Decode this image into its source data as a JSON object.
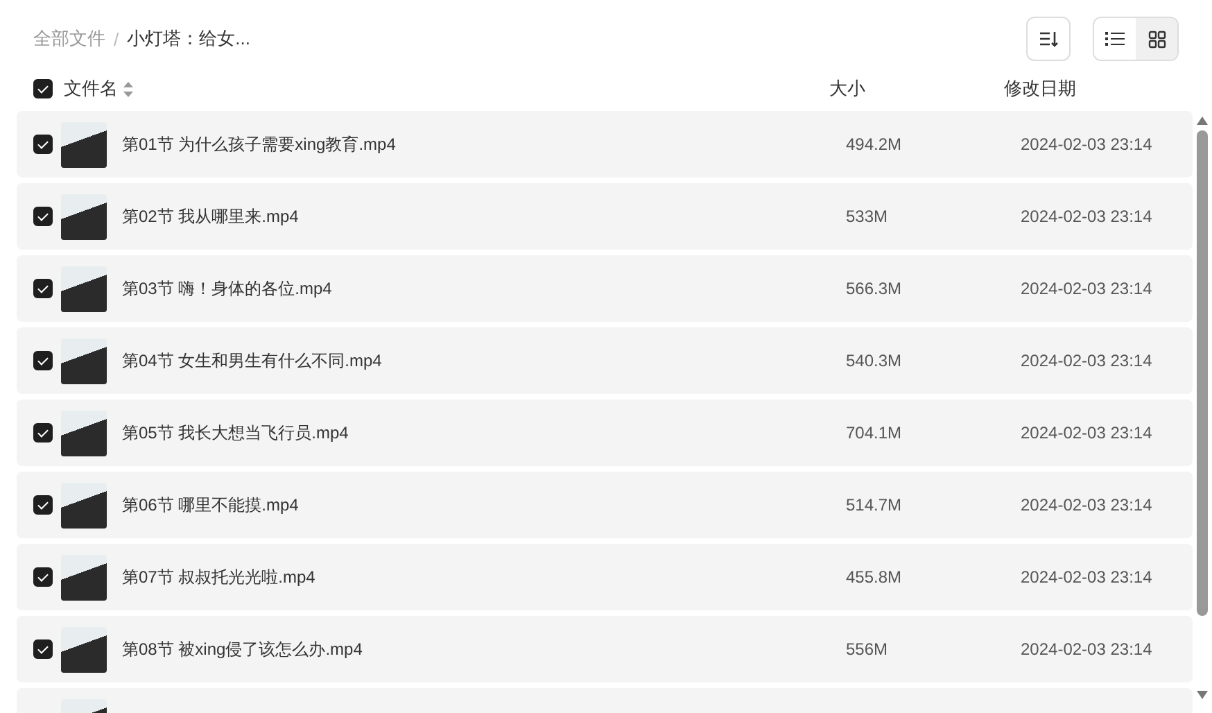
{
  "breadcrumb": [
    {
      "label": "全部文件",
      "current": false
    },
    {
      "label": "小灯塔：给女...",
      "current": true
    }
  ],
  "separator": "/",
  "view_modes": [
    {
      "kind": "list",
      "selected": false
    },
    {
      "kind": "grid",
      "selected": true
    }
  ],
  "table": {
    "select_all_checked": true,
    "columns": [
      {
        "label": "文件名",
        "sortable": true
      },
      {
        "label": "大小",
        "sortable": false
      },
      {
        "label": "修改日期",
        "sortable": false
      }
    ],
    "rows": [
      {
        "checked": true,
        "name": "第01节 为什么孩子需要xing教育.mp4",
        "size": "494.2M",
        "modified": "2024-02-03 23:14"
      },
      {
        "checked": true,
        "name": "第02节 我从哪里来.mp4",
        "size": "533M",
        "modified": "2024-02-03 23:14"
      },
      {
        "checked": true,
        "name": "第03节 嗨！身体的各位.mp4",
        "size": "566.3M",
        "modified": "2024-02-03 23:14"
      },
      {
        "checked": true,
        "name": "第04节 女生和男生有什么不同.mp4",
        "size": "540.3M",
        "modified": "2024-02-03 23:14"
      },
      {
        "checked": true,
        "name": "第05节 我长大想当飞行员.mp4",
        "size": "704.1M",
        "modified": "2024-02-03 23:14"
      },
      {
        "checked": true,
        "name": "第06节 哪里不能摸.mp4",
        "size": "514.7M",
        "modified": "2024-02-03 23:14"
      },
      {
        "checked": true,
        "name": "第07节 叔叔托光光啦.mp4",
        "size": "455.8M",
        "modified": "2024-02-03 23:14"
      },
      {
        "checked": true,
        "name": "第08节 被xing侵了该怎么办.mp4",
        "size": "556M",
        "modified": "2024-02-03 23:14"
      }
    ]
  }
}
